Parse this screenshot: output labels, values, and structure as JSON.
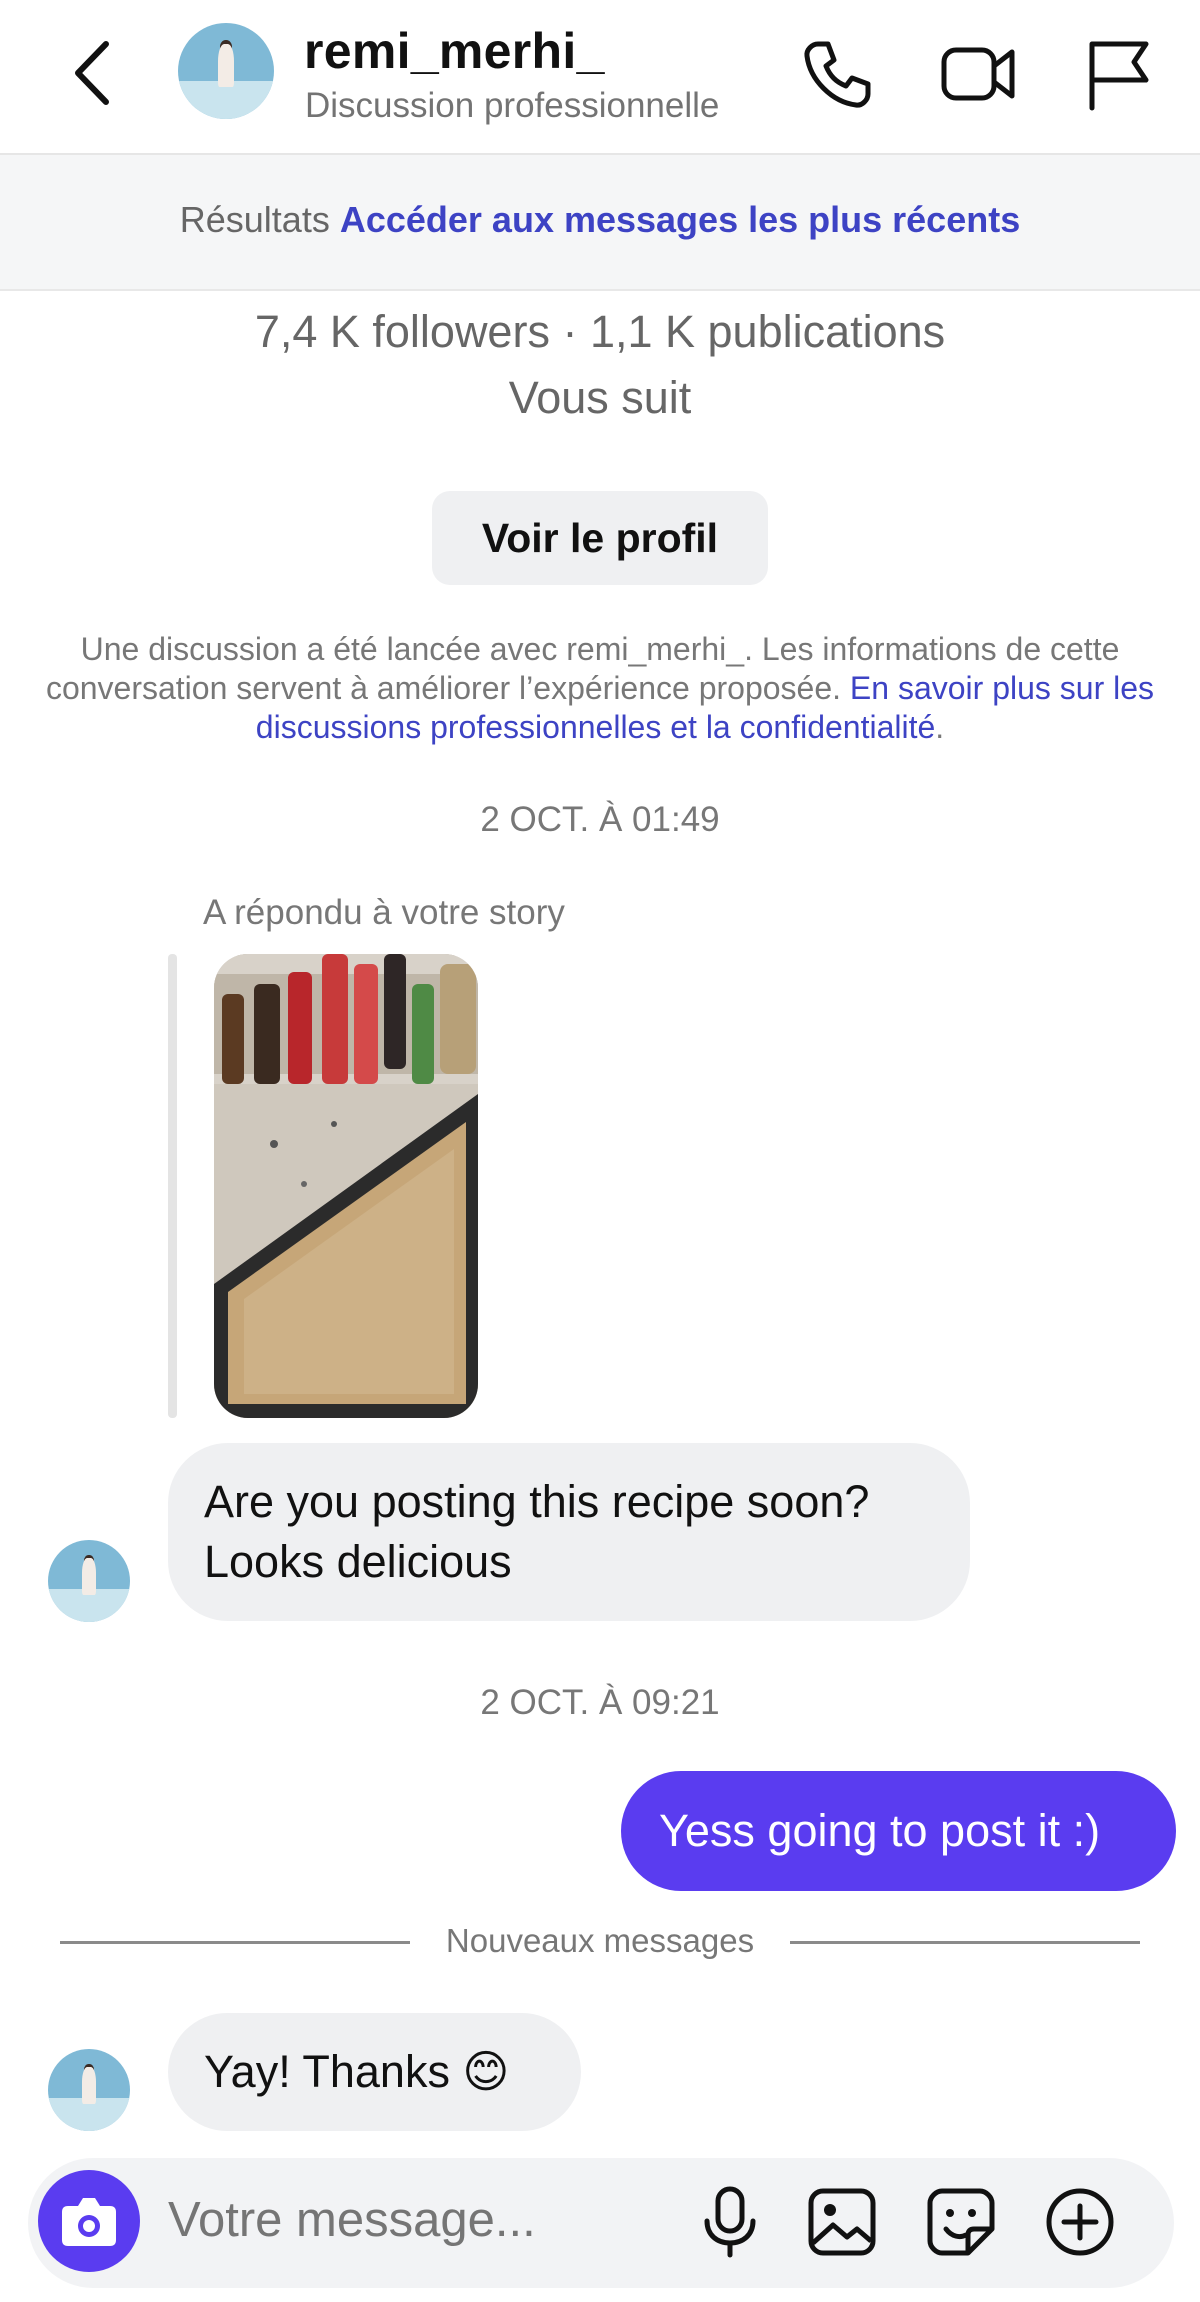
{
  "header": {
    "username": "remi_merhi_",
    "subtitle": "Discussion professionnelle",
    "icons": [
      "chevron-left-icon",
      "phone-icon",
      "video-camera-icon",
      "flag-icon"
    ]
  },
  "banner": {
    "results_label": "Résultats",
    "recent_link": "Accéder aux messages les plus récents"
  },
  "profile": {
    "stats": "7,4 K followers · 1,1 K publications",
    "follows_you": "Vous suit",
    "view_profile_button": "Voir le profil"
  },
  "disclaimer": {
    "text": "Une discussion a été lancée avec remi_merhi_. Les informations de cette conversation servent à améliorer l’expérience proposée.",
    "link": "En savoir plus sur les discussions professionnelles et la confidentialité",
    "end": "."
  },
  "thread": {
    "timestamp_1": "2 OCT. À 01:49",
    "story_reply_label": "A répondu à votre story",
    "message_1_line1": "Are you posting this recipe soon?",
    "message_1_line2": "Looks delicious",
    "timestamp_2": "2 OCT. À 09:21",
    "message_2": "Yess going to post it :)",
    "new_messages_label": "Nouveaux messages",
    "message_3": "Yay! Thanks 😊"
  },
  "composer": {
    "placeholder": "Votre message...",
    "icons": [
      "camera-icon",
      "microphone-icon",
      "gallery-icon",
      "sticker-icon",
      "plus-circle-icon"
    ]
  },
  "colors": {
    "accent": "#5a3cf0",
    "link": "#3d43c4",
    "bubble_incoming": "#eff0f2",
    "muted_text": "#737373"
  }
}
